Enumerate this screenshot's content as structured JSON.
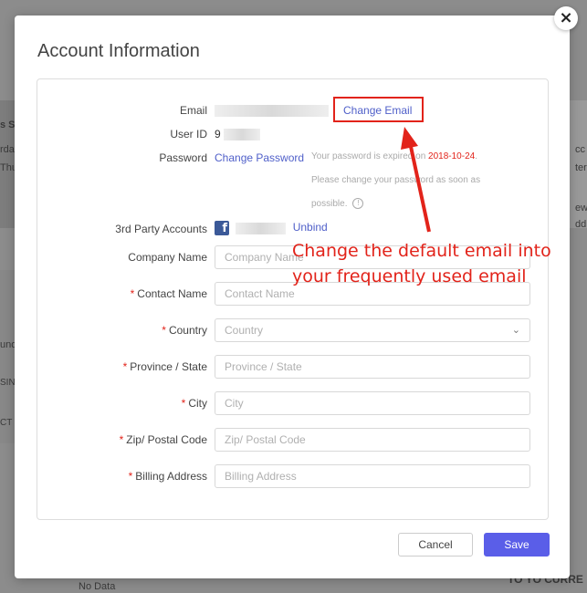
{
  "background": {
    "fragments": [
      "s Sc",
      "rda",
      "Thu",
      "und",
      "SIN",
      "CT",
      "cc",
      "ter",
      "ew",
      "dd",
      "No Data",
      "TO YO CURRE"
    ]
  },
  "modal": {
    "title": "Account Information",
    "close_symbol": "×"
  },
  "account": {
    "email_label": "Email",
    "change_email_label": "Change Email",
    "user_id_label": "User ID",
    "user_id_value": "9",
    "password_label": "Password",
    "change_password_label": "Change Password",
    "password_hint_prefix": "Your password is expired on ",
    "password_expiry_date": "2018-10-24",
    "password_hint_suffix": ".",
    "password_hint_line2": "Please change your password as soon as",
    "password_hint_line3": "possible.",
    "info_icon_symbol": "!",
    "third_party_label": "3rd Party Accounts",
    "facebook_symbol": "f",
    "unbind_label": "Unbind"
  },
  "form": {
    "required_mark": "*",
    "company_name": {
      "label": "Company Name",
      "placeholder": "Company Name",
      "value": ""
    },
    "contact_name": {
      "label": "Contact Name",
      "placeholder": "Contact Name",
      "value": ""
    },
    "country": {
      "label": "Country",
      "placeholder": "Country",
      "chevron": "⌄"
    },
    "province": {
      "label": "Province / State",
      "placeholder": "Province / State",
      "value": ""
    },
    "city": {
      "label": "City",
      "placeholder": "City",
      "value": ""
    },
    "zip": {
      "label": "Zip/ Postal Code",
      "placeholder": "Zip/ Postal Code",
      "value": ""
    },
    "billing": {
      "label": "Billing Address",
      "placeholder": "Billing Address",
      "value": ""
    }
  },
  "actions": {
    "cancel_label": "Cancel",
    "save_label": "Save"
  },
  "annotation": {
    "text": "Change the default email into your frequently used email",
    "color": "#e2231a"
  },
  "colors": {
    "accent": "#5a5ee8",
    "link": "#4f5fc9",
    "required": "#e2231a",
    "facebook": "#3b5998"
  }
}
